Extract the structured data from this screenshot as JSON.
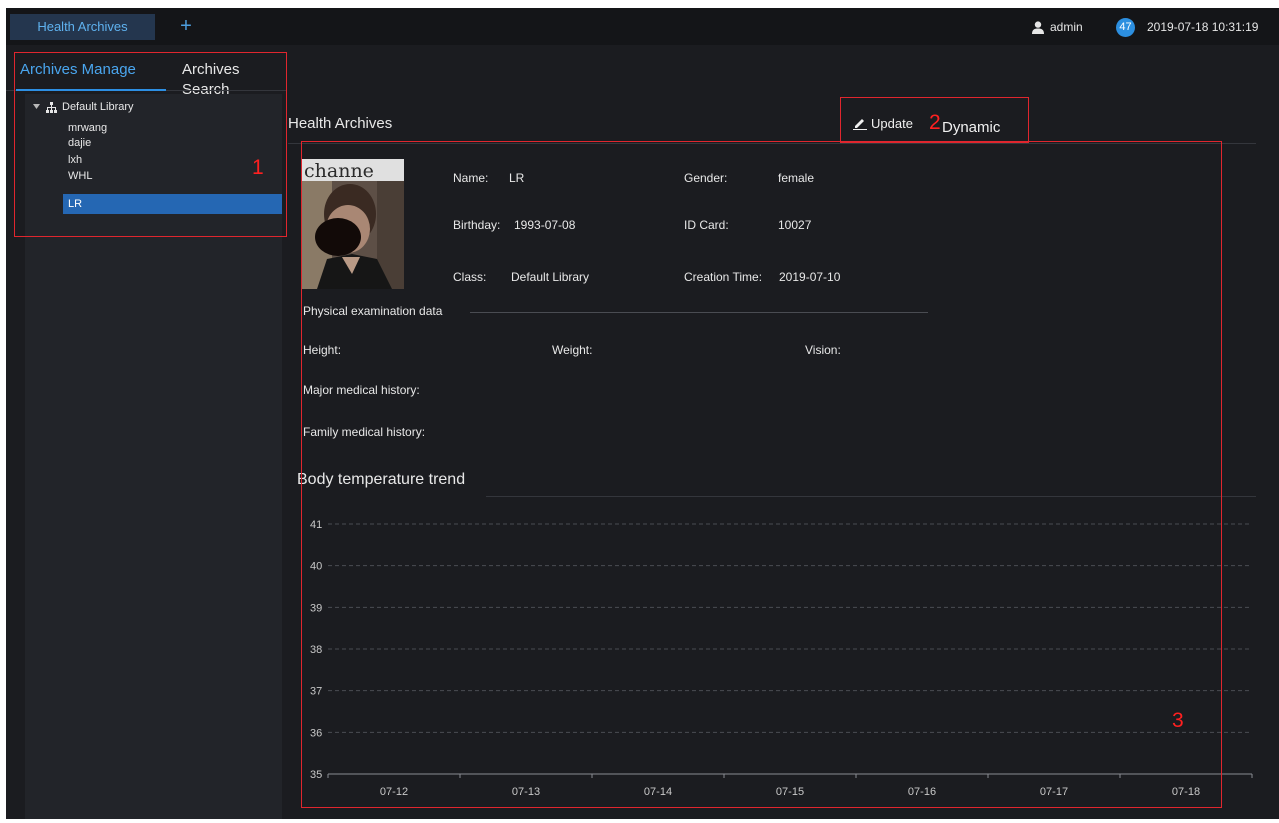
{
  "topbar": {
    "tab_label": "Health Archives",
    "add_tab_symbol": "+",
    "user_name": "admin",
    "notification_count": "47",
    "datetime": "2019-07-18 10:31:19"
  },
  "subtabs": {
    "manage": "Archives Manage",
    "search": "Archives Search"
  },
  "tree": {
    "root_label": "Default Library",
    "items": [
      "mrwang",
      "dajie",
      "lxh",
      "WHL",
      "LR"
    ],
    "selected": "LR"
  },
  "panel": {
    "title": "Health Archives",
    "update_label": "Update",
    "dynamic_label": "Dynamic"
  },
  "profile": {
    "photo_caption": "channe",
    "name_label": "Name:",
    "name_value": "LR",
    "gender_label": "Gender:",
    "gender_value": "female",
    "birthday_label": "Birthday:",
    "birthday_value": "1993-07-08",
    "id_label": "ID Card:",
    "id_value": "10027",
    "class_label": "Class:",
    "class_value": "Default Library",
    "creation_label": "Creation Time:",
    "creation_value": "2019-07-10"
  },
  "physical": {
    "section_title": "Physical examination data",
    "height_label": "Height:",
    "weight_label": "Weight:",
    "vision_label": "Vision:",
    "major_history_label": "Major medical history:",
    "family_history_label": "Family medical history:"
  },
  "chart_title": "Body temperature trend",
  "chart_data": {
    "type": "line",
    "title": "Body temperature trend",
    "categories": [
      "07-12",
      "07-13",
      "07-14",
      "07-15",
      "07-16",
      "07-17",
      "07-18"
    ],
    "y_ticks": [
      "35",
      "36",
      "37",
      "38",
      "39",
      "40",
      "41"
    ],
    "ylim": [
      35,
      41
    ],
    "series": [],
    "grid": true,
    "grid_style": "dashed",
    "xlabel": "",
    "ylabel": ""
  },
  "annotations": [
    "1",
    "2",
    "3"
  ],
  "colors": {
    "accent": "#2d8fe3",
    "selected_row": "#2567b3",
    "annotation": "#e0262e",
    "background": "#1b1c20"
  },
  "icons": {
    "user": "user-icon",
    "tree_expand": "caret-down-icon",
    "library": "org-tree-icon",
    "update": "pencil-icon"
  }
}
